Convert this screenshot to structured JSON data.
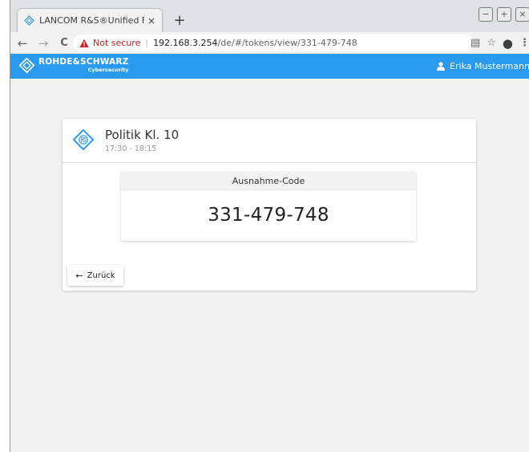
{
  "browser": {
    "tab_title": "LANCOM R&S®Unified Firewall",
    "tab_close": "×",
    "new_tab": "+",
    "window_controls": [
      "−",
      "+",
      "×"
    ],
    "nav": {
      "back": "←",
      "forward": "→",
      "reload": "C"
    },
    "security_label": "Not secure",
    "separator": "|",
    "url_host": "192.168.3.254",
    "url_path": "/de/#/tokens/view/331-479-748",
    "toolbar_icons": {
      "translate": "▤",
      "bookmark": "☆",
      "profile": "●",
      "menu": "⋮"
    }
  },
  "header": {
    "brand_name": "ROHDE&SCHWARZ",
    "brand_sub": "Cybersecurity",
    "user_name": "Erika Mustermann"
  },
  "card": {
    "title": "Politik Kl. 10",
    "time": "17:30 - 18:15",
    "code_label": "Ausnahme-Code",
    "code_value": "331-479-748",
    "back_arrow": "←",
    "back_label": "Zurück"
  },
  "colors": {
    "brand_blue": "#2a9aee",
    "warning_red": "#c5221f"
  }
}
